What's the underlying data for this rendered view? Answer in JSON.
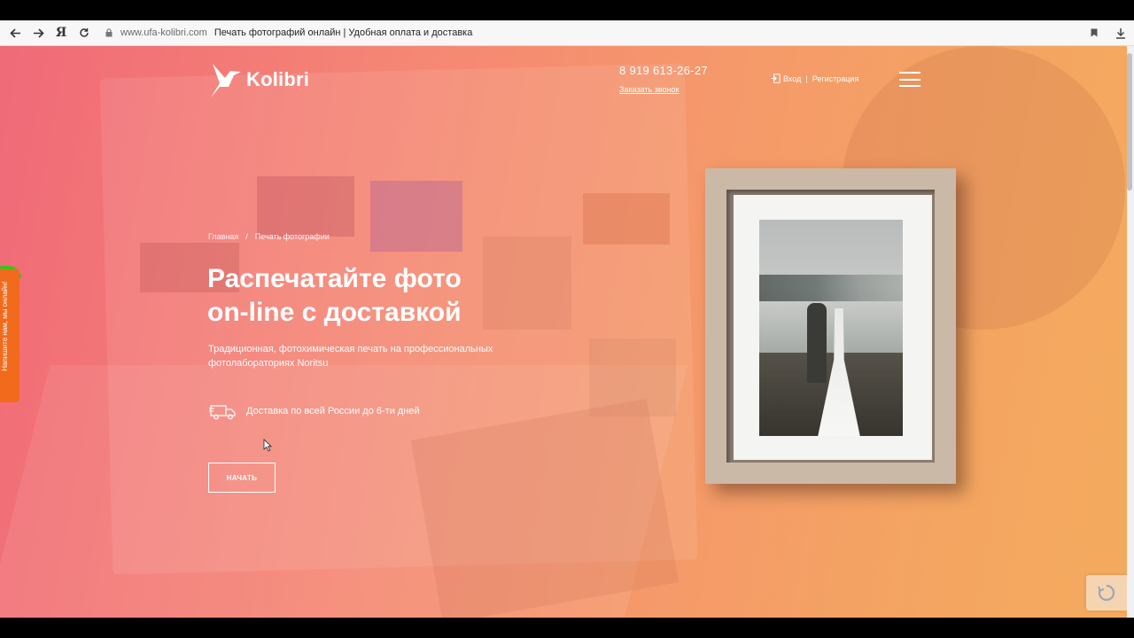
{
  "browser": {
    "url_host": "www.ufa-kolibri.com",
    "page_title": "Печать фотографий онлайн | Удобная оплата и доставка",
    "yandex_glyph": "Я"
  },
  "header": {
    "logo_text": "Kolibri",
    "phone": "8 919 613-26-27",
    "callback_link": "Заказать звонок",
    "login_link": "Вход",
    "auth_separator": "|",
    "register_link": "Регистрация"
  },
  "breadcrumb": {
    "home": "Главная",
    "separator": "/",
    "current": "Печать фотографии"
  },
  "hero": {
    "title_line1": "Распечатайте фото",
    "title_line2": "on-line с доставкой",
    "subtitle": "Традиционная, фотохимическая печать на профессиональных фотолабораториях Noritsu",
    "delivery_text": "Доставка по всей России до 6-ти дней",
    "start_button": "НАЧАТЬ"
  },
  "feedback_tab": {
    "label": "Напишите нам, мы онлайн!"
  },
  "colors": {
    "gradient_start": "#f06a78",
    "gradient_end": "#f3ab5e",
    "feedback_orange": "#f26a1b",
    "online_green": "#3ec11a",
    "frame_wood": "#cbb9a8"
  }
}
